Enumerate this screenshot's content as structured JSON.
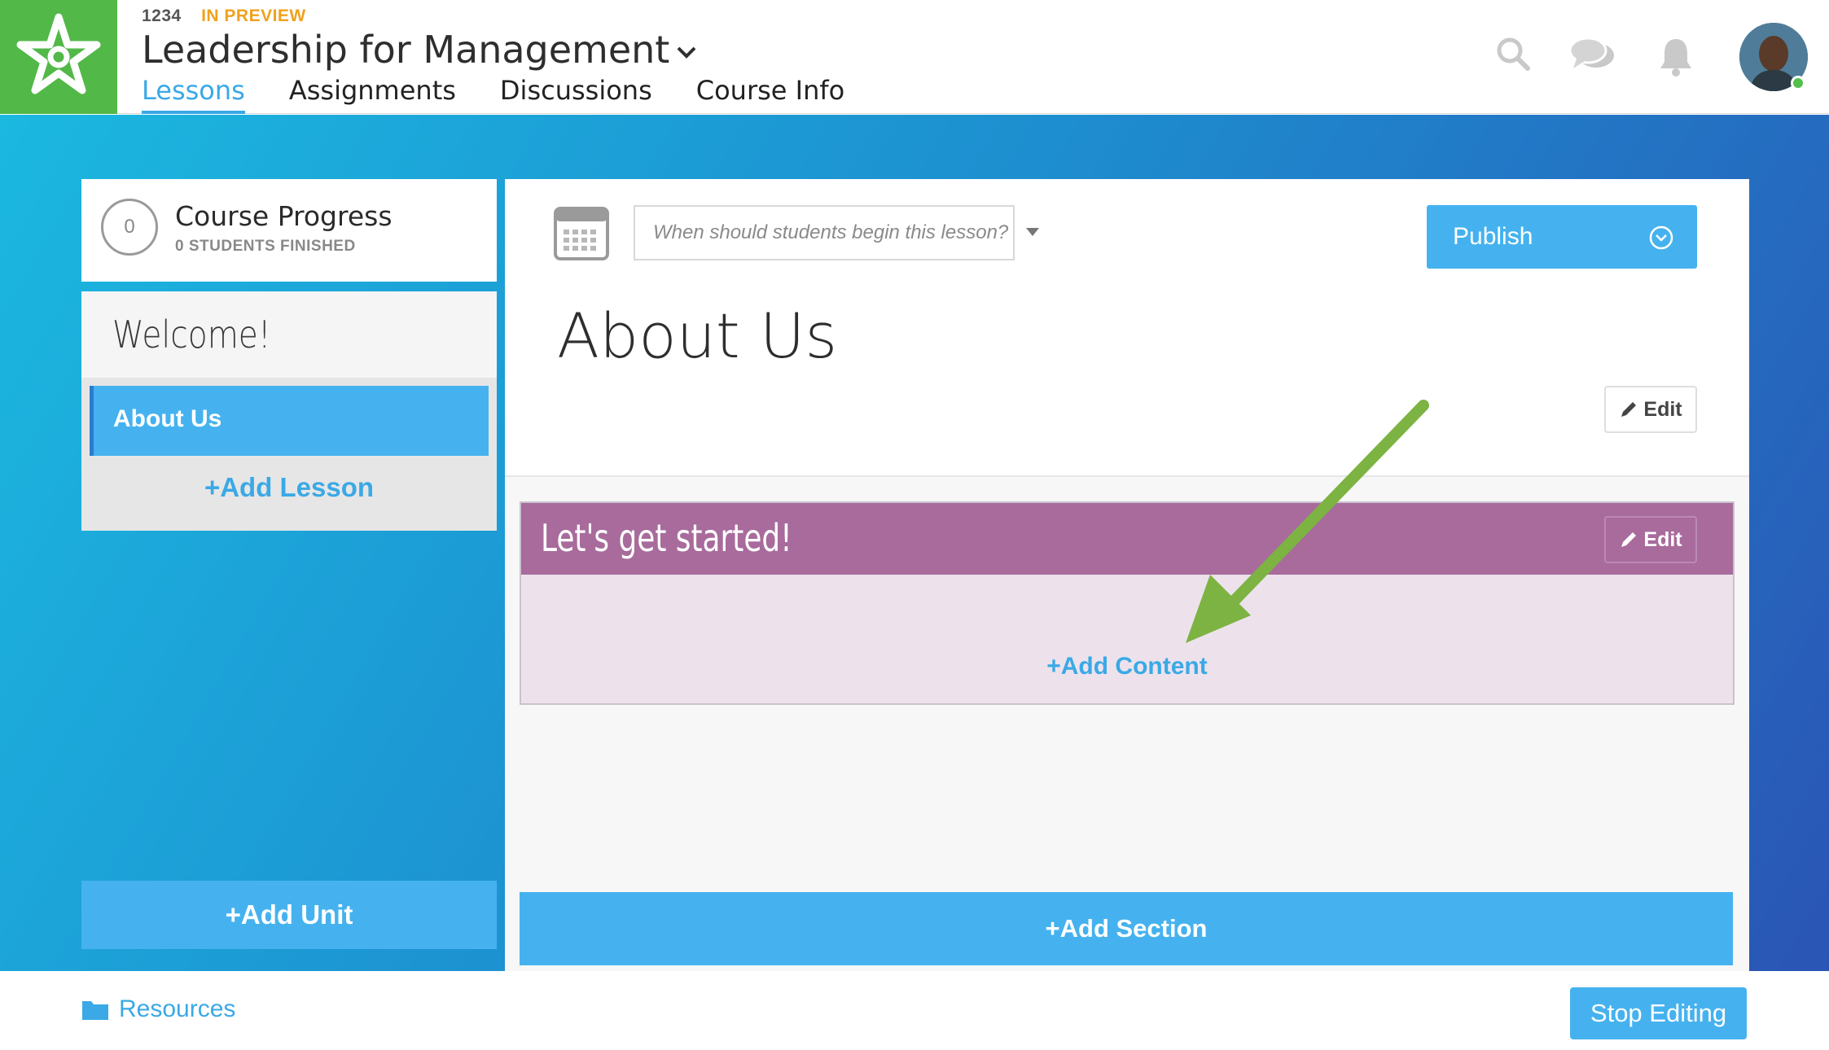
{
  "header": {
    "course_id": "1234",
    "status": "IN PREVIEW",
    "title": "Leadership for Management",
    "tabs": [
      "Lessons",
      "Assignments",
      "Discussions",
      "Course Info"
    ],
    "active_tab": "Lessons",
    "icons": [
      "search-icon",
      "chat-icon",
      "bell-icon"
    ]
  },
  "sidebar": {
    "progress": {
      "count": "0",
      "title": "Course Progress",
      "subtitle": "0 STUDENTS FINISHED"
    },
    "unit": {
      "title": "Welcome!",
      "lessons": [
        "About Us"
      ],
      "add_lesson_label": "+Add Lesson"
    },
    "add_unit_label": "+Add Unit"
  },
  "lesson": {
    "date_placeholder": "When should students begin this lesson?",
    "publish_label": "Publish",
    "title": "About Us",
    "edit_label": "Edit",
    "sections": [
      {
        "title": "Let's get started!",
        "edit_label": "Edit",
        "add_content_label": "+Add Content",
        "color": "#a86b9c"
      }
    ],
    "add_section_label": "+Add Section"
  },
  "footer": {
    "resources_label": "Resources",
    "stop_editing_label": "Stop Editing"
  },
  "colors": {
    "brand_green": "#52b848",
    "accent_blue": "#45b2ef",
    "link_blue": "#3aa9e6",
    "status_orange": "#f0a21e",
    "section_purple": "#a86b9c",
    "arrow_green": "#7cb342"
  }
}
